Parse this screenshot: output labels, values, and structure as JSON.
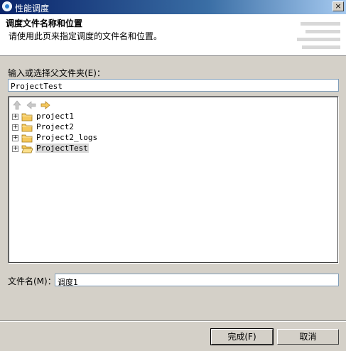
{
  "window": {
    "title": "性能调度",
    "close_glyph": "×"
  },
  "header": {
    "title": "调度文件名称和位置",
    "description": "请使用此页来指定调度的文件名和位置。"
  },
  "parent_folder": {
    "label": "输入或选择父文件夹(E)：",
    "value": "ProjectTest"
  },
  "toolbar": {
    "icons": [
      "up-arrow-icon",
      "back-arrow-icon",
      "forward-arrow-icon"
    ]
  },
  "tree": {
    "items": [
      {
        "label": "project1",
        "selected": false
      },
      {
        "label": "Project2",
        "selected": false
      },
      {
        "label": "Project2_logs",
        "selected": false
      },
      {
        "label": "ProjectTest",
        "selected": true
      }
    ],
    "expander_glyph": "+"
  },
  "file_name": {
    "label": "文件名(M)：",
    "value": "调度1"
  },
  "buttons": {
    "finish": "完成(F)",
    "cancel": "取消"
  },
  "colors": {
    "title_start": "#0a246a",
    "title_end": "#a6caf0",
    "dialog_bg": "#d4d0c8",
    "folder": "#f5c85c"
  }
}
